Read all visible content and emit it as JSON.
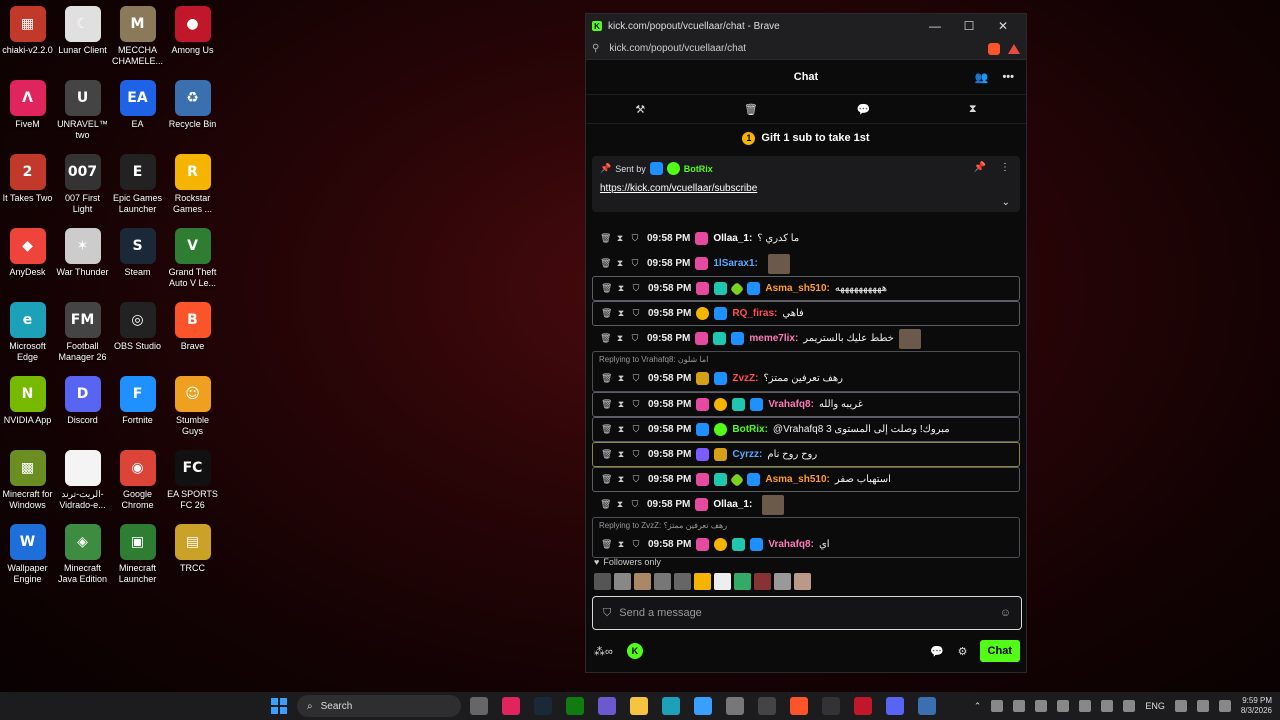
{
  "desktop": {
    "icons": [
      {
        "label": "chiaki-v2.2.0",
        "color": "#c0392b",
        "glyph": "▦"
      },
      {
        "label": "Lunar Client",
        "color": "#e0e0e0",
        "glyph": "☾"
      },
      {
        "label": "MECCHA CHAMELE...",
        "color": "#8a7a5a",
        "glyph": "M"
      },
      {
        "label": "Among Us",
        "color": "#c0182a",
        "glyph": "●"
      },
      {
        "label": "FiveM",
        "color": "#e0245e",
        "glyph": "Λ"
      },
      {
        "label": "UNRAVEL™ two",
        "color": "#444",
        "glyph": "U"
      },
      {
        "label": "EA",
        "color": "#1e63e6",
        "glyph": "EA"
      },
      {
        "label": "Recycle Bin",
        "color": "#3a6fb0",
        "glyph": "♻"
      },
      {
        "label": "It Takes Two",
        "color": "#c0392b",
        "glyph": "2"
      },
      {
        "label": "007 First Light",
        "color": "#333",
        "glyph": "007"
      },
      {
        "label": "Epic Games Launcher",
        "color": "#222",
        "glyph": "E"
      },
      {
        "label": "Rockstar Games ...",
        "color": "#f5b400",
        "glyph": "R"
      },
      {
        "label": "AnyDesk",
        "color": "#ef443b",
        "glyph": "◆"
      },
      {
        "label": "War Thunder",
        "color": "#ccc",
        "glyph": "✶"
      },
      {
        "label": "Steam",
        "color": "#1b2838",
        "glyph": "S"
      },
      {
        "label": "Grand Theft Auto V Le...",
        "color": "#2f7d32",
        "glyph": "V"
      },
      {
        "label": "Microsoft Edge",
        "color": "#1da1b8",
        "glyph": "e"
      },
      {
        "label": "Football Manager 26",
        "color": "#444",
        "glyph": "FM"
      },
      {
        "label": "OBS Studio",
        "color": "#222",
        "glyph": "◎"
      },
      {
        "label": "Brave",
        "color": "#fb542b",
        "glyph": "B"
      },
      {
        "label": "NVIDIA App",
        "color": "#76b900",
        "glyph": "N"
      },
      {
        "label": "Discord",
        "color": "#5865f2",
        "glyph": "D"
      },
      {
        "label": "Fortnite",
        "color": "#1e90ff",
        "glyph": "F"
      },
      {
        "label": "Stumble Guys",
        "color": "#f0a020",
        "glyph": "☺"
      },
      {
        "label": "Minecraft for Windows",
        "color": "#6b8e23",
        "glyph": "▩"
      },
      {
        "label": "الريت-ترند-Vidrado-e...",
        "color": "#f4f4f4",
        "glyph": " "
      },
      {
        "label": "Google Chrome",
        "color": "#db4437",
        "glyph": "◉"
      },
      {
        "label": "EA SPORTS FC 26",
        "color": "#111",
        "glyph": "FC"
      },
      {
        "label": "Wallpaper Engine",
        "color": "#1e6fd9",
        "glyph": "W"
      },
      {
        "label": "Minecraft Java Edition",
        "color": "#3d8c40",
        "glyph": "◈"
      },
      {
        "label": "Minecraft Launcher",
        "color": "#2e7d32",
        "glyph": "▣"
      },
      {
        "label": "TRCC",
        "color": "#c9a227",
        "glyph": "▤"
      }
    ]
  },
  "window": {
    "title": "kick.com/popout/vcuellaar/chat - Brave",
    "url": "kick.com/popout/vcuellaar/chat",
    "minimize": "—",
    "maximize": "☐",
    "close": "✕"
  },
  "chat": {
    "header": "Chat",
    "gift_text": "Gift 1 sub to take 1st",
    "pinned": {
      "sent_by": "Sent by",
      "sender": "BotRix",
      "link": "https://kick.com/vcuellaar/subscribe"
    },
    "messages": [
      {
        "time": "09:58 PM",
        "user": "Ollaa_1:",
        "ucls": "u-white",
        "badges": [
          "b-pink"
        ],
        "text": "ما كدري ؟",
        "emote": false,
        "hl": ""
      },
      {
        "time": "09:58 PM",
        "user": "1lSarax1:",
        "ucls": "u-blue",
        "badges": [
          "b-pink"
        ],
        "text": "",
        "emote": true,
        "hl": ""
      },
      {
        "time": "09:58 PM",
        "user": "Asma_sh510:",
        "ucls": "u-orange",
        "badges": [
          "b-pink",
          "b-teal",
          "b-lime",
          "b-blue"
        ],
        "text": "ههههههههههه",
        "emote": false,
        "hl": "hl"
      },
      {
        "time": "09:58 PM",
        "user": "RQ_firas:",
        "ucls": "u-red",
        "badges": [
          "b-gold",
          "b-blue"
        ],
        "text": "فاهي",
        "emote": false,
        "hl": "hl"
      },
      {
        "time": "09:58 PM",
        "user": "meme7lix:",
        "ucls": "u-pink",
        "badges": [
          "b-pink",
          "b-teal",
          "b-blue"
        ],
        "text": "خطط عليك بالستريمر",
        "emote": true,
        "hl": ""
      }
    ],
    "reply1": {
      "label": "Replying to Vrahafq8: اما شلون",
      "msg": {
        "time": "09:58 PM",
        "user": "ZvzZ:",
        "ucls": "u-red",
        "badges": [
          "b-crown",
          "b-blue"
        ],
        "text": "رهف تعرفين ممتز؟"
      }
    },
    "messages2": [
      {
        "time": "09:58 PM",
        "user": "Vrahafq8:",
        "ucls": "u-pink",
        "badges": [
          "b-pink",
          "b-gold",
          "b-teal",
          "b-blue"
        ],
        "text": "غريبه والله",
        "emote": false,
        "hl": "hl"
      },
      {
        "time": "09:58 PM",
        "user": "BotRix:",
        "ucls": "u-green",
        "badges": [
          "b-blue",
          "b-green"
        ],
        "text": "@Vrahafq8 مبروك! وصلت إلى المستوى 3",
        "emote": false,
        "hl": "hl"
      },
      {
        "time": "09:58 PM",
        "user": "Cyrzz:",
        "ucls": "u-blue",
        "badges": [
          "b-purple",
          "b-crown"
        ],
        "text": "روح روح نام",
        "emote": false,
        "hl": "hl-y"
      },
      {
        "time": "09:58 PM",
        "user": "Asma_sh510:",
        "ucls": "u-orange",
        "badges": [
          "b-pink",
          "b-teal",
          "b-lime",
          "b-blue"
        ],
        "text": "استهباب صفر",
        "emote": false,
        "hl": "hl"
      },
      {
        "time": "09:58 PM",
        "user": "Ollaa_1:",
        "ucls": "u-white",
        "badges": [
          "b-pink"
        ],
        "text": "",
        "emote": true,
        "hl": ""
      }
    ],
    "reply2": {
      "label": "Replying to ZvzZ: رهف تعرفين ممتز؟",
      "msg": {
        "time": "09:58 PM",
        "user": "Vrahafq8:",
        "ucls": "u-pink",
        "badges": [
          "b-pink",
          "b-gold",
          "b-teal",
          "b-blue"
        ],
        "text": "اي"
      }
    },
    "followers_only": "Followers only",
    "input_placeholder": "Send a message",
    "send_label": "Chat"
  },
  "taskbar": {
    "search_label": "Search",
    "lang": "ENG",
    "time": "9:59 PM",
    "date": "8/3/2026"
  }
}
